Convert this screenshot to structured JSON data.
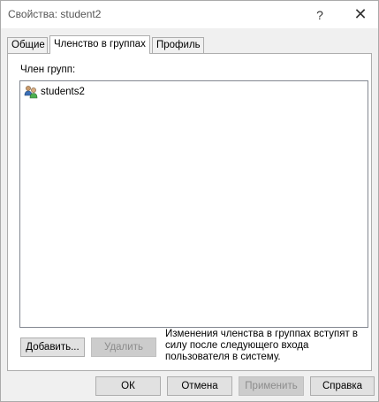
{
  "window": {
    "title": "Свойства: student2",
    "help_glyph": "?",
    "close_glyph": "✕"
  },
  "tabs": [
    {
      "label": "Общие",
      "active": false
    },
    {
      "label": "Членство в группах",
      "active": true
    },
    {
      "label": "Профиль",
      "active": false
    }
  ],
  "membership": {
    "label": "Член групп:",
    "groups": [
      {
        "name": "students2",
        "icon": "group-icon"
      }
    ]
  },
  "actions": {
    "add_label": "Добавить...",
    "remove_label": "Удалить",
    "note": "Изменения членства в группах вступят в силу после следующего входа пользователя в систему."
  },
  "footer": {
    "ok_label": "ОК",
    "cancel_label": "Отмена",
    "apply_label": "Применить",
    "help_label": "Справка"
  }
}
